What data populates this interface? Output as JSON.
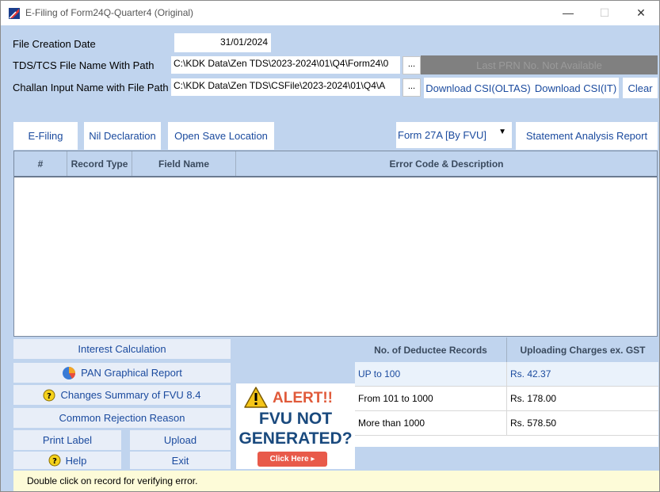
{
  "window": {
    "title": "E-Filing of Form24Q-Quarter4 (Original)",
    "minimize": "—",
    "maximize": "☐",
    "close": "✕"
  },
  "form": {
    "file_creation_date_label": "File Creation Date",
    "file_creation_date_value": "31/01/2024",
    "file_name_label": "TDS/TCS File Name With Path",
    "file_name_value": "C:\\KDK Data\\Zen TDS\\2023-2024\\01\\Q4\\Form24\\0",
    "challan_label": "Challan Input Name with File Path",
    "challan_value": "C:\\KDK Data\\Zen TDS\\CSFile\\2023-2024\\01\\Q4\\A",
    "browse_label": "...",
    "last_prn": "Last PRN No. Not Available",
    "download_oltas": "Download CSI(OLTAS)",
    "download_it": "Download CSI(IT)",
    "clear": "Clear"
  },
  "toolbar": {
    "efiling": "E-Filing",
    "nil_declaration": "Nil Declaration",
    "open_save_location": "Open Save Location",
    "form_select": "Form 27A [By FVU]",
    "statement_analysis": "Statement Analysis Report"
  },
  "grid": {
    "columns": [
      "#",
      "Record Type",
      "Field Name",
      "Error Code & Description"
    ]
  },
  "actions": {
    "interest_calculation": "Interest Calculation",
    "pan_graphical_report": "PAN Graphical Report",
    "changes_summary": "Changes Summary of FVU 8.4",
    "common_rejection": "Common Rejection Reason",
    "print_label": "Print Label",
    "upload": "Upload",
    "help": "Help",
    "exit": "Exit"
  },
  "alert": {
    "word": "ALERT!!",
    "line1": "FVU NOT",
    "line2": "GENERATED?",
    "click_here": "Click Here ▸"
  },
  "charges": {
    "headers": [
      "No. of Deductee Records",
      "Uploading Charges ex. GST"
    ],
    "rows": [
      {
        "range": "UP to 100",
        "charge": "Rs. 42.37"
      },
      {
        "range": "From 101 to 1000",
        "charge": "Rs. 178.00"
      },
      {
        "range": "More than 1000",
        "charge": "Rs. 578.50"
      }
    ]
  },
  "status": {
    "text": "Double click on record for verifying error."
  },
  "colors": {
    "window_bg": "#c0d4ee",
    "link_blue": "#1a4a9e",
    "alert_red": "#e05a3a",
    "status_bg": "#fdfbd8"
  }
}
